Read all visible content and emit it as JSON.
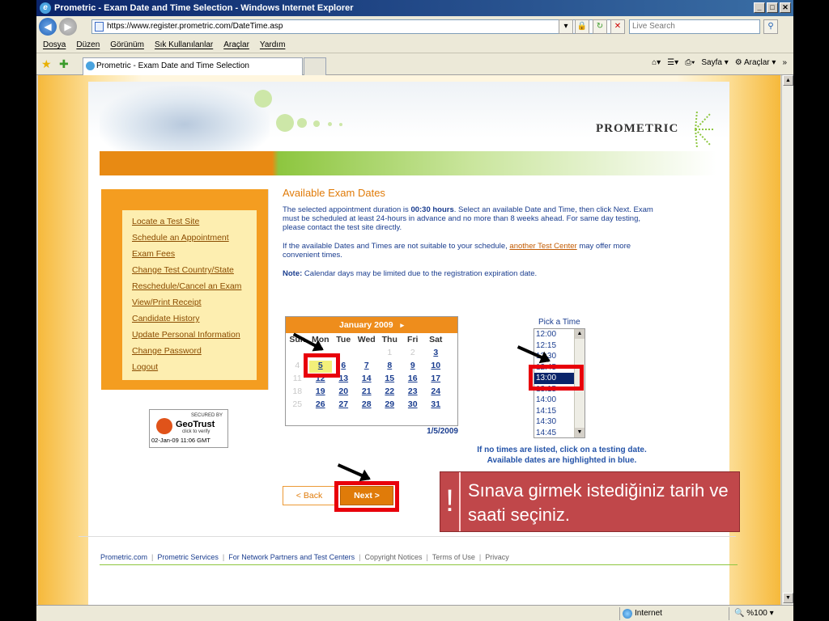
{
  "browser": {
    "title": "Prometric - Exam Date and Time Selection - Windows Internet Explorer",
    "url": "https://www.register.prometric.com/DateTime.asp",
    "search_placeholder": "Live Search",
    "menu": [
      "Dosya",
      "Düzen",
      "Görünüm",
      "Sık Kullanılanlar",
      "Araçlar",
      "Yardım"
    ],
    "tab_title": "Prometric - Exam Date and Time Selection",
    "cmd_page": "Sayfa",
    "cmd_tools": "Araçlar",
    "status_zone": "Internet",
    "status_zoom": "%100"
  },
  "logo": "PROMETRIC",
  "sidebar": {
    "links": [
      "Locate a Test Site",
      "Schedule an Appointment",
      "Exam Fees",
      "Change Test Country/State",
      "Reschedule/Cancel an Exam",
      "View/Print Receipt",
      "Candidate History",
      "Update Personal Information",
      "Change Password",
      "Logout"
    ]
  },
  "geotrust": {
    "secured": "SECURED BY",
    "name": "GeoTrust",
    "verify": "click to verify",
    "date": "02-Jan-09 11:06 GMT"
  },
  "main": {
    "heading": "Available Exam Dates",
    "p1_a": "The selected appointment duration is ",
    "p1_b": "00:30 hours",
    "p1_c": ". Select an available Date and Time, then click Next. Exam must be scheduled at least 24-hours in advance and no more than 8 weeks ahead. For same day testing, please contact the test site directly.",
    "p2_a": "If the available Dates and Times are not suitable to your schedule, ",
    "p2_link": "another Test Center",
    "p2_c": " may offer more convenient times.",
    "p3_a": "Note:",
    "p3_b": " Calendar days may be limited due to the registration expiration date."
  },
  "calendar": {
    "month": "January 2009",
    "next_arrow": "▸",
    "dow": [
      "Sun",
      "Mon",
      "Tue",
      "Wed",
      "Thu",
      "Fri",
      "Sat"
    ],
    "selected_date": "1/5/2009",
    "days": [
      {
        "d": "",
        "on": false
      },
      {
        "d": "",
        "on": false
      },
      {
        "d": "",
        "on": false
      },
      {
        "d": "",
        "on": false
      },
      {
        "d": "1",
        "on": false
      },
      {
        "d": "2",
        "on": false
      },
      {
        "d": "3",
        "on": true
      },
      {
        "d": "4",
        "on": false
      },
      {
        "d": "5",
        "on": true,
        "sel": true
      },
      {
        "d": "6",
        "on": true
      },
      {
        "d": "7",
        "on": true
      },
      {
        "d": "8",
        "on": true
      },
      {
        "d": "9",
        "on": true
      },
      {
        "d": "10",
        "on": true
      },
      {
        "d": "11",
        "on": false
      },
      {
        "d": "12",
        "on": true
      },
      {
        "d": "13",
        "on": true
      },
      {
        "d": "14",
        "on": true
      },
      {
        "d": "15",
        "on": true
      },
      {
        "d": "16",
        "on": true
      },
      {
        "d": "17",
        "on": true
      },
      {
        "d": "18",
        "on": false
      },
      {
        "d": "19",
        "on": true
      },
      {
        "d": "20",
        "on": true
      },
      {
        "d": "21",
        "on": true
      },
      {
        "d": "22",
        "on": true
      },
      {
        "d": "23",
        "on": true
      },
      {
        "d": "24",
        "on": true
      },
      {
        "d": "25",
        "on": false
      },
      {
        "d": "26",
        "on": true
      },
      {
        "d": "27",
        "on": true
      },
      {
        "d": "28",
        "on": true
      },
      {
        "d": "29",
        "on": true
      },
      {
        "d": "30",
        "on": true
      },
      {
        "d": "31",
        "on": true
      }
    ]
  },
  "times": {
    "label": "Pick a Time",
    "slots": [
      "12:00",
      "12:15",
      "12:30",
      "12:45",
      "13:00",
      "13:15",
      "14:00",
      "14:15",
      "14:30",
      "14:45"
    ],
    "selected": "13:00"
  },
  "hint": "If no times are listed, click on a testing date. Available dates are highlighted in blue.",
  "buttons": {
    "back": "< Back",
    "next": "Next >"
  },
  "footer": [
    "Prometric.com",
    "Prometric Services",
    "For Network Partners and Test Centers",
    "Copyright Notices",
    "Terms of Use",
    "Privacy"
  ],
  "callout": {
    "icon": "!",
    "text": "Sınava girmek istediğiniz tarih ve saati seçiniz."
  },
  "colors": {
    "accent_orange": "#e07b09",
    "link_blue": "#1a3d8f",
    "highlight_red": "#e8000b",
    "callout_bg": "#c0474a"
  }
}
